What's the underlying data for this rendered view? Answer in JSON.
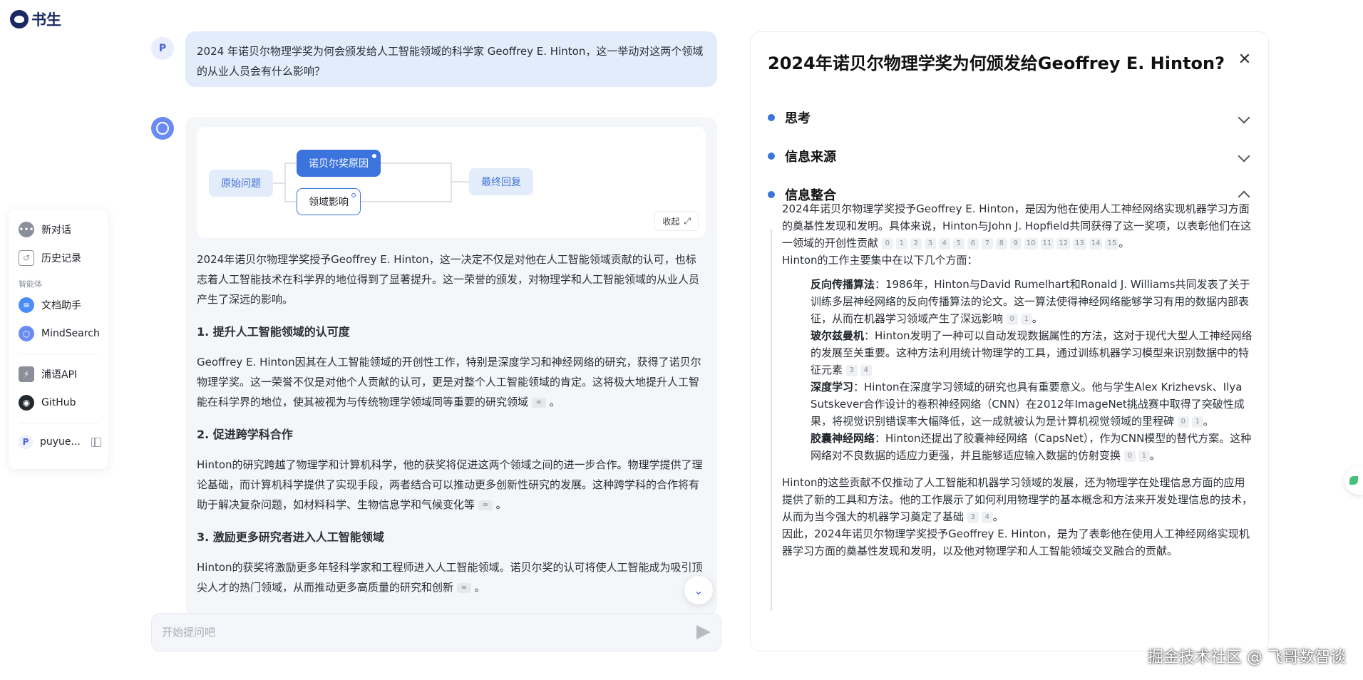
{
  "app": {
    "logo_text": "书生"
  },
  "sidebar": {
    "items": [
      {
        "label": "新对话",
        "icon": "chat-bubble-icon",
        "color": "#8a8f99"
      },
      {
        "label": "历史记录",
        "icon": "history-icon",
        "color": "#8a8f99"
      }
    ],
    "section_label": "智能体",
    "agents": [
      {
        "label": "文档助手",
        "icon": "document-assistant-icon",
        "color": "#4b8df8"
      },
      {
        "label": "MindSearch",
        "icon": "mindsearch-icon",
        "color": "#6a8cf2"
      }
    ],
    "links": [
      {
        "label": "浦语API",
        "icon": "api-icon",
        "color": "#8a8f99"
      },
      {
        "label": "GitHub",
        "icon": "github-icon",
        "color": "#24292e"
      }
    ],
    "user": {
      "avatar_letter": "P",
      "name": "puyue..."
    }
  },
  "chat": {
    "user_avatar": "P",
    "user_message": "2024 年诺贝尔物理学奖为何会颁发给人工智能领域的科学家 Geoffrey E. Hinton，这一举动对这两个领域的从业人员会有什么影响？",
    "mindmap": {
      "origin": "原始问题",
      "reason": "诺贝尔奖原因",
      "field": "领域影响",
      "final": "最终回复",
      "collapse_label": "收起"
    },
    "answer": {
      "intro": "2024年诺贝尔物理学奖授予Geoffrey E. Hinton，这一决定不仅是对他在人工智能领域贡献的认可，也标志着人工智能技术在科学界的地位得到了显著提升。这一荣誉的颁发，对物理学和人工智能领域的从业人员产生了深远的影响。",
      "h1": "1. 提升人工智能领域的认可度",
      "p1": "Geoffrey E. Hinton因其在人工智能领域的开创性工作，特别是深度学习和神经网络的研究，获得了诺贝尔物理学奖。这一荣誉不仅是对他个人贡献的认可，更是对整个人工智能领域的肯定。这将极大地提升人工智能在科学界的地位，使其被视为与传统物理学领域同等重要的研究领域",
      "h2": "2. 促进跨学科合作",
      "p2": "Hinton的研究跨越了物理学和计算机科学，他的获奖将促进这两个领域之间的进一步合作。物理学提供了理论基础，而计算机科学提供了实现手段，两者结合可以推动更多创新性研究的发展。这种跨学科的合作将有助于解决复杂问题，如材料科学、生物信息学和气候变化等",
      "h3": "3. 激励更多研究者进入人工智能领域",
      "p3": "Hinton的获奖将激励更多年轻科学家和工程师进入人工智能领域。诺贝尔奖的认可将使人工智能成为吸引顶尖人才的热门领域，从而推动更多高质量的研究和创新"
    },
    "input_placeholder": "开始提问吧"
  },
  "detail": {
    "title": "2024年诺贝尔物理学奖为何颁发给Geoffrey E. Hinton?",
    "sections": [
      "思考",
      "信息来源",
      "信息整合"
    ],
    "intro": "2024年诺贝尔物理学奖授予Geoffrey E. Hinton，是因为他在使用人工神经网络实现机器学习方面的奠基性发现和发明。具体来说，Hinton与John J. Hopfield共同获得了这一奖项，以表彰他们在这一领域的开创性贡献",
    "intro_cites": [
      "0",
      "1",
      "2",
      "3",
      "4",
      "5",
      "6",
      "7",
      "8",
      "9",
      "10",
      "11",
      "12",
      "13",
      "14",
      "15"
    ],
    "intro2": "Hinton的工作主要集中在以下几个方面：",
    "list": [
      {
        "term": "反向传播算法",
        "text": "：1986年，Hinton与David Rumelhart和Ronald J. Williams共同发表了关于训练多层神经网络的反向传播算法的论文。这一算法使得神经网络能够学习有用的数据内部表征，从而在机器学习领域产生了深远影响",
        "cites": [
          "0",
          "1"
        ]
      },
      {
        "term": "玻尔兹曼机",
        "text": "：Hinton发明了一种可以自动发现数据属性的方法，这对于现代大型人工神经网络的发展至关重要。这种方法利用统计物理学的工具，通过训练机器学习模型来识别数据中的特征元素",
        "cites": [
          "3",
          "4"
        ]
      },
      {
        "term": "深度学习",
        "text": "：Hinton在深度学习领域的研究也具有重要意义。他与学生Alex Krizhevsk、Ilya Sutskever合作设计的卷积神经网络（CNN）在2012年ImageNet挑战赛中取得了突破性成果，将视觉识别错误率大幅降低，这一成就被认为是计算机视觉领域的里程碑",
        "cites": [
          "0",
          "1"
        ]
      },
      {
        "term": "胶囊神经网络",
        "text": "：Hinton还提出了胶囊神经网络（CapsNet），作为CNN模型的替代方案。这种网络对不良数据的适应力更强，并且能够适应输入数据的仿射变换",
        "cites": [
          "0",
          "1"
        ]
      }
    ],
    "conclusion1": "Hinton的这些贡献不仅推动了人工智能和机器学习领域的发展，还为物理学在处理信息方面的应用提供了新的工具和方法。他的工作展示了如何利用物理学的基本概念和方法来开发处理信息的技术，从而为当今强大的机器学习奠定了基础",
    "conclusion1_cites": [
      "3",
      "4"
    ],
    "conclusion2": "因此，2024年诺贝尔物理学奖授予Geoffrey E. Hinton，是为了表彰他在使用人工神经网络实现机器学习方面的奠基性发现和发明，以及他对物理学和人工智能领域交叉融合的贡献。"
  },
  "watermark": "掘金技术社区 @ 飞哥数智谈",
  "colors": {
    "accent": "#3b74dd",
    "bubble": "#e2ecfb",
    "card": "#f4f6fa"
  }
}
